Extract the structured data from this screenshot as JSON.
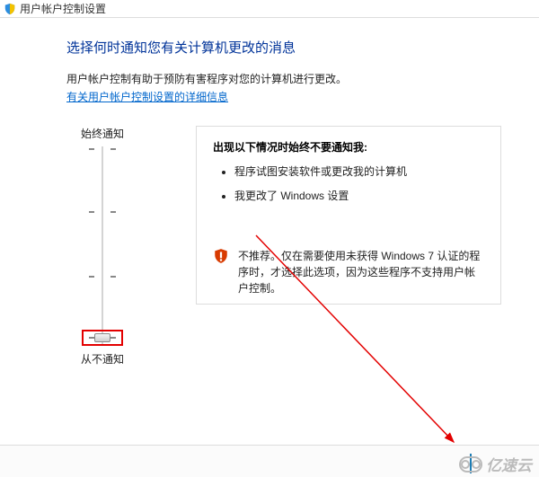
{
  "window": {
    "title": "用户帐户控制设置"
  },
  "page": {
    "heading": "选择何时通知您有关计算机更改的消息",
    "description": "用户帐户控制有助于预防有害程序对您的计算机进行更改。",
    "help_link": "有关用户帐户控制设置的详细信息"
  },
  "slider": {
    "top_label": "始终通知",
    "bottom_label": "从不通知",
    "levels": 4,
    "current_level": 0
  },
  "panel": {
    "title": "出现以下情况时始终不要通知我:",
    "items": [
      "程序试图安装软件或更改我的计算机",
      "我更改了 Windows 设置"
    ],
    "warning": "不推荐。仅在需要使用未获得 Windows 7 认证的程序时，才选择此选项，因为这些程序不支持用户帐户控制。"
  },
  "watermark": {
    "text": "亿速云"
  }
}
